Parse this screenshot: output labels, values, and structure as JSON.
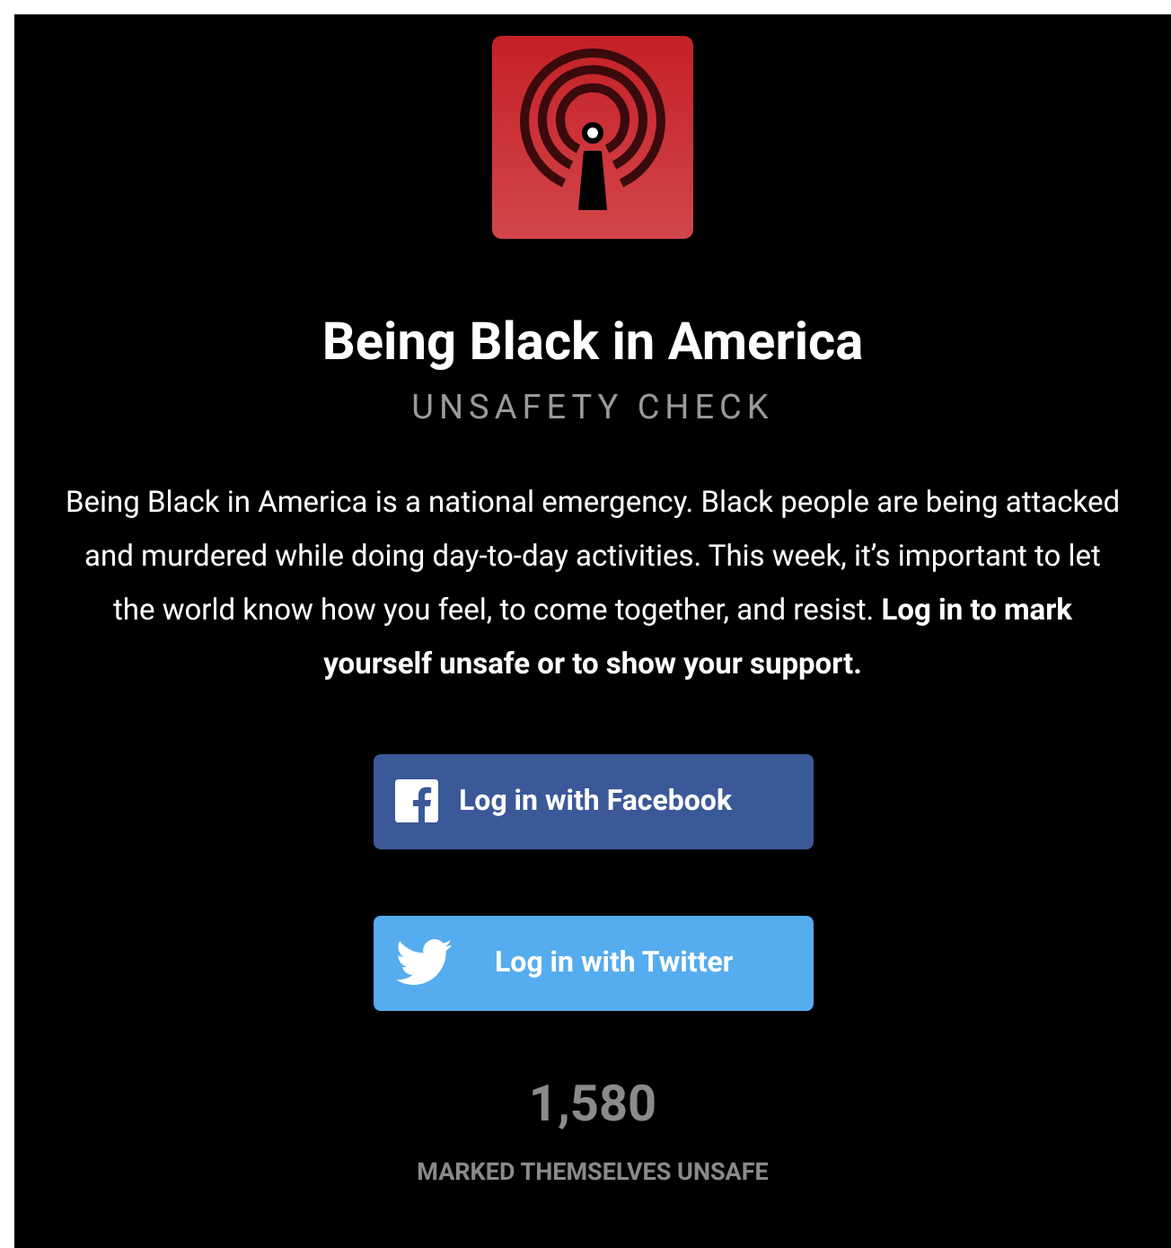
{
  "title": "Being Black in America",
  "subtitle": "UNSAFETY CHECK",
  "description": "Being Black in America is a national emergency. Black people are being attacked and murdered while doing day-to-day activities. This week, it’s important to let the world know how you feel, to come together, and resist. **Log in to mark yourself unsafe or to show your support.**",
  "buttons": [
    {
      "kind": "facebook",
      "label": "Log in with Facebook"
    },
    {
      "kind": "twitter",
      "label": "Log in with Twitter"
    }
  ],
  "count": "1,580",
  "count_label": "MARKED THEMSELVES UNSAFE"
}
